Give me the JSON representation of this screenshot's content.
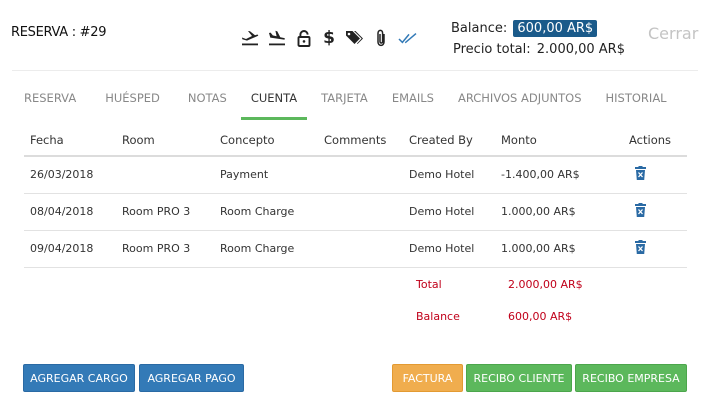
{
  "header": {
    "reservation_label": "RESERVA : #29",
    "balance_label": "Balance:",
    "balance_value": "600,00 AR$",
    "precio_label": "Precio total:",
    "precio_value": "2.000,00 AR$",
    "close_label": "Cerrar",
    "icons": [
      "plane-departure-icon",
      "plane-arrival-icon",
      "lock-icon",
      "dollar-icon",
      "tags-icon",
      "paperclip-icon",
      "double-check-icon"
    ],
    "dollar_glyph": "$"
  },
  "tabs": [
    {
      "label": "RESERVA",
      "active": false
    },
    {
      "label": "HUÉSPED",
      "active": false
    },
    {
      "label": "NOTAS",
      "active": false
    },
    {
      "label": "CUENTA",
      "active": true
    },
    {
      "label": "TARJETA",
      "active": false
    },
    {
      "label": "EMAILS",
      "active": false
    },
    {
      "label": "ARCHIVOS ADJUNTOS",
      "active": false
    },
    {
      "label": "HISTORIAL",
      "active": false
    }
  ],
  "table": {
    "headers": {
      "fecha": "Fecha",
      "room": "Room",
      "concepto": "Concepto",
      "comments": "Comments",
      "created_by": "Created By",
      "monto": "Monto",
      "actions": "Actions"
    },
    "rows": [
      {
        "fecha": "26/03/2018",
        "room": "",
        "concepto": "Payment",
        "comments": "",
        "created_by": "Demo Hotel",
        "monto": "-1.400,00 AR$"
      },
      {
        "fecha": "08/04/2018",
        "room": "Room PRO 3",
        "concepto": "Room Charge",
        "comments": "",
        "created_by": "Demo Hotel",
        "monto": "1.000,00 AR$"
      },
      {
        "fecha": "09/04/2018",
        "room": "Room PRO 3",
        "concepto": "Room Charge",
        "comments": "",
        "created_by": "Demo Hotel",
        "monto": "1.000,00 AR$"
      }
    ]
  },
  "totals": {
    "total_label": "Total",
    "total_value": "2.000,00 AR$",
    "balance_label": "Balance",
    "balance_value": "600,00 AR$"
  },
  "buttons": {
    "agregar_cargo": "AGREGAR CARGO",
    "agregar_pago": "AGREGAR PAGO",
    "factura": "FACTURA",
    "recibo_cliente": "RECIBO CLIENTE",
    "recibo_empresa": "RECIBO EMPRESA"
  },
  "colors": {
    "balance_badge": "#1a5a8a",
    "active_tab_underline": "#5cb85c",
    "totals_text": "#c0001a",
    "btn_blue": "#337ab7",
    "btn_orange": "#f0ad4e",
    "btn_green": "#5cb85c",
    "trash_icon": "#2a6aa4"
  }
}
